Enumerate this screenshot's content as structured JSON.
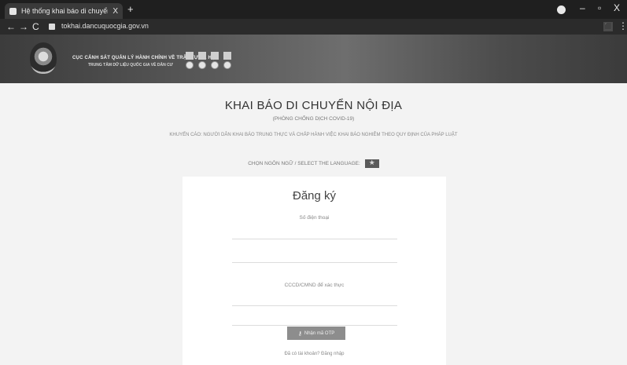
{
  "browser": {
    "tab_title": "Hệ thống khai báo di chuyển nội",
    "tab_close": "X",
    "new_tab": "+",
    "url": "tokhai.dancuquocgia.gov.vn",
    "icons": {
      "back": "←",
      "forward": "→",
      "reload": "C",
      "minimize": "–",
      "maximize": "▫",
      "close": "X",
      "menu": "⋮"
    }
  },
  "site_header": {
    "org_line1": "CỤC CẢNH SÁT QUẢN LÝ HÀNH CHÍNH VỀ TRẬT TỰ XÃ HỘI",
    "org_line2": "TRUNG TÂM DỮ LIỆU QUỐC GIA VỀ DÂN CƯ"
  },
  "main": {
    "title": "KHAI BÁO DI CHUYỂN NỘI ĐỊA",
    "subtitle": "(PHÒNG CHỐNG DỊCH COVID-19)",
    "warning": "KHUYẾN CÁO: NGƯỜI DÂN KHAI BÁO TRUNG THỰC VÀ CHẤP HÀNH VIỆC KHAI BÁO NGHIÊM THEO QUY ĐỊNH CỦA PHÁP LUẬT",
    "language_label": "CHỌN NGÔN NGỮ / SELECT THE LANGUAGE:"
  },
  "form": {
    "heading": "Đăng ký",
    "phone_label": "Số điện thoại",
    "id_label": "CCCD/CMND để xác thực",
    "otp_button": "Nhận mã OTP",
    "login_link": "Đã có tài khoản? Đăng nhập"
  }
}
